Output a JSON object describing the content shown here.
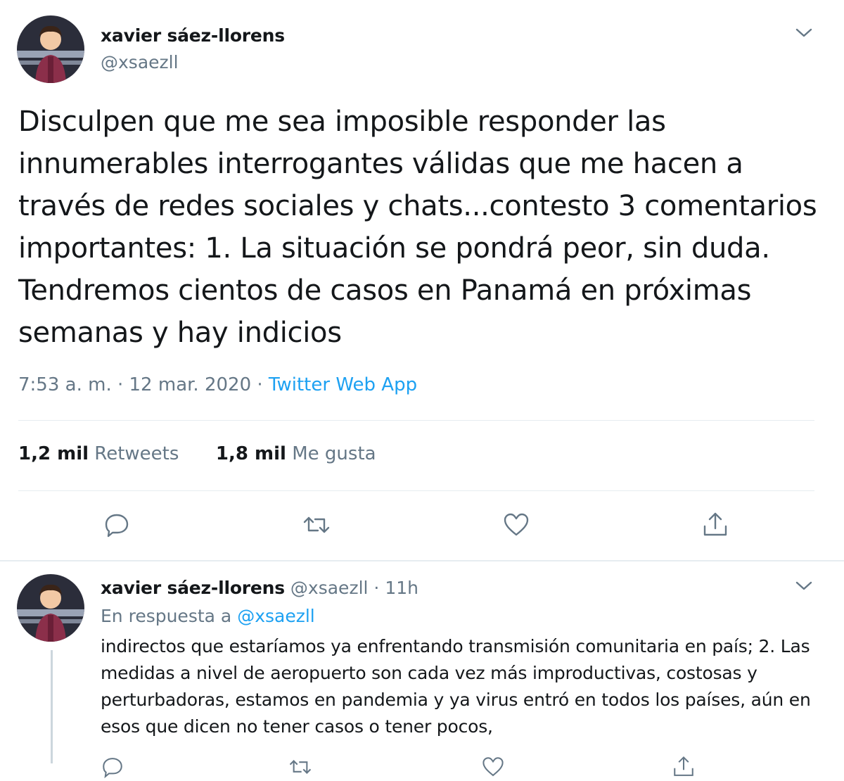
{
  "tweet": {
    "author_name": "xavier sáez-llorens",
    "handle": "@xsaezll",
    "text": "Disculpen que me sea imposible responder las innumerables interrogantes válidas que me hacen a través de redes sociales y chats...contesto 3 comentarios importantes: 1. La situación se pondrá peor, sin duda. Tendremos cientos de casos en Panamá en próximas semanas y hay indicios",
    "time": "7:53 a. m.",
    "separator": " · ",
    "date": "12 mar. 2020",
    "source": "Twitter Web App",
    "retweets_count": "1,2 mil",
    "retweets_label": "Retweets",
    "likes_count": "1,8 mil",
    "likes_label": "Me gusta",
    "actions": [
      "reply-icon",
      "retweet-icon",
      "like-icon",
      "share-icon"
    ],
    "menu_icon": "chevron-down-icon"
  },
  "reply": {
    "author_name": "xavier sáez-llorens",
    "handle": "@xsaezll",
    "dot": " · ",
    "age": "11h",
    "in_reply_prefix": "En respuesta a ",
    "in_reply_handle": "@xsaezll",
    "text": "indirectos que estaríamos ya enfrentando transmisión comunitaria en país; 2. Las medidas a nivel de aeropuerto son cada vez más improductivas, costosas y perturbadoras, estamos en pandemia y ya virus entró en todos los países, aún en esos que dicen no tener casos o tener pocos,",
    "menu_icon": "chevron-down-icon"
  },
  "colors": {
    "link": "#1da1f2",
    "muted": "#657786",
    "text": "#14171a",
    "divider": "#e6ecf0"
  }
}
